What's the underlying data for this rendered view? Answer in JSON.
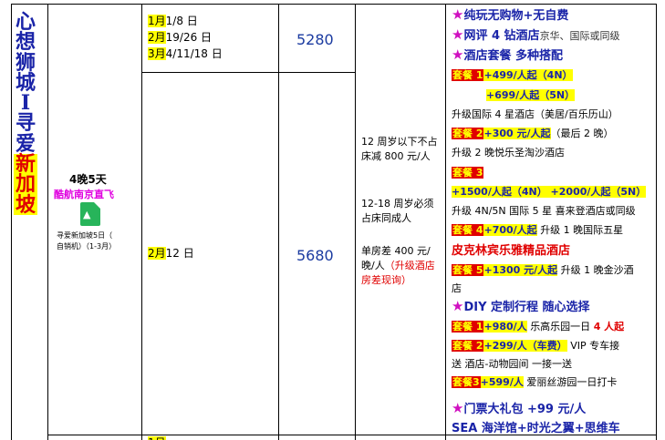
{
  "title_chars": [
    "心",
    "想",
    "狮",
    "城",
    "I",
    "寻",
    "爱",
    "新",
    "加",
    "坡"
  ],
  "duration": "4晚5天",
  "airline": "酷航南京直飞",
  "pdf_icon": "pdf-file-icon",
  "pdf_caption_1": "寻爱新加坡5日（",
  "pdf_caption_2": "自销机）（1-3月）",
  "rows": [
    {
      "dates": [
        {
          "month": "1月",
          "days": "1/8 日"
        },
        {
          "month": "2月",
          "days": "19/26 日"
        },
        {
          "month": "3月",
          "days": "4/11/18 日"
        }
      ],
      "price": "5280"
    },
    {
      "dates": [
        {
          "month": "2月",
          "days": "12 日"
        }
      ],
      "price": "5680"
    }
  ],
  "notes": {
    "child_under_12": "12 周岁以下不占床减 800 元/人",
    "child_12_18": "12-18 周岁必须占床同成人",
    "single_room_1": "单房差 400 元/晚/人",
    "single_room_2": "（升级酒店房差现询）"
  },
  "features": {
    "f1": "纯玩无购物+无自费",
    "f2_main": "网评 4 钻酒店",
    "f2_sub": "京华、国际或同级",
    "f3": "酒店套餐 多种搭配",
    "p1_label": "套餐 1",
    "p1_price_a": "+499/人起（4N）",
    "p1_price_b": "+699/人起（5N）",
    "p1_desc": "升级国际 4 星酒店（美居/百乐历山）",
    "p2_label": "套餐 2",
    "p2_price": "+300 元/人起",
    "p2_note": "（最后 2 晚）",
    "p2_desc": "升级 2 晚悦乐圣淘沙酒店",
    "p3_label": "套餐 3",
    "p3_price": "+1500/人起（4N） +2000/人起（5N）",
    "p3_desc": "升级 4N/5N 国际 5 星 喜来登酒店或同级",
    "p4_label": "套餐 4",
    "p4_price": "+700/人起",
    "p4_desc": "升级 1 晚国际五星",
    "p4_hotel": "皮克林宾乐雅精品酒店",
    "p5_label": "套餐 5",
    "p5_price": "+1300 元/人起",
    "p5_desc_a": "升级 1 晚金沙酒",
    "p5_desc_b": "店",
    "diy": "DIY 定制行程 随心选择",
    "d1_label": "套餐 1",
    "d1_price": "+980/人",
    "d1_desc": "乐高乐园一日",
    "d1_note": "4 人起",
    "d2_label": "套餐 2",
    "d2_price": "+299/人（车费）",
    "d2_desc_a": "VIP 专车接",
    "d2_desc_b": "送 酒店-动物园间 一接一送",
    "d3_label": "套餐3",
    "d3_price": "+599/人",
    "d3_desc": "爱丽丝游园一日打卡",
    "ticket": "门票大礼包 +99 元/人",
    "ticket_sub": "SEA 海洋馆+时光之翼+思维车"
  },
  "bottom_partial": "1月"
}
